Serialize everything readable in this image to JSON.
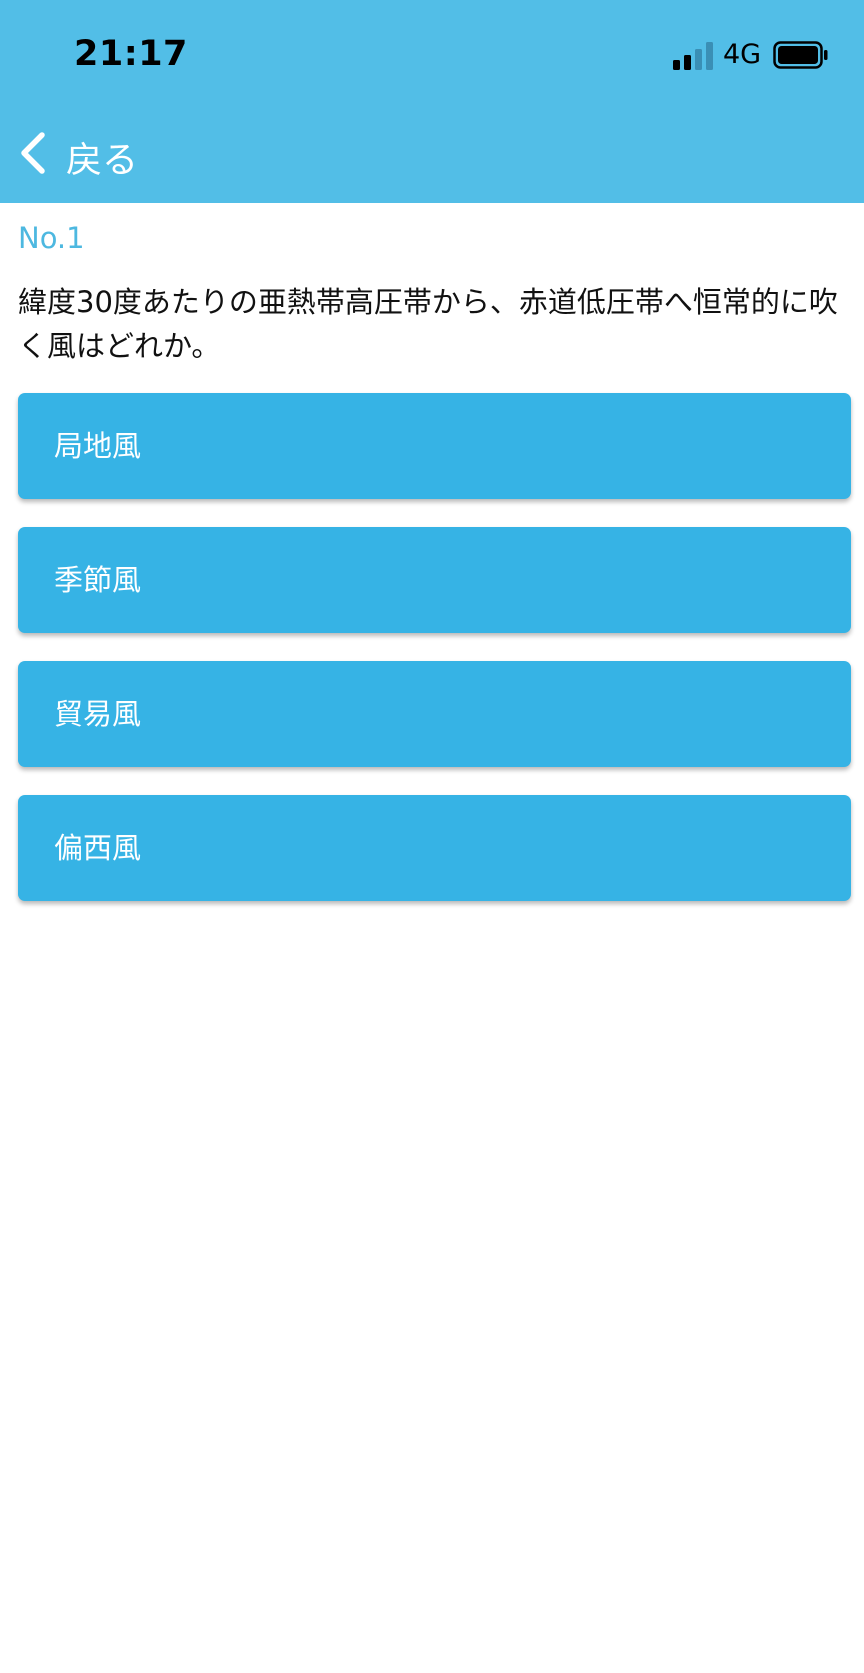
{
  "status_bar": {
    "time": "21:17",
    "network": "4G"
  },
  "nav": {
    "back_label": "戻る",
    "back_icon": "chevron-left-icon"
  },
  "question": {
    "number_label": "No.1",
    "text": "緯度30度あたりの亜熱帯高圧帯から、赤道低圧帯へ恒常的に吹く風はどれか。"
  },
  "choices": [
    {
      "label": "局地風"
    },
    {
      "label": "季節風"
    },
    {
      "label": "貿易風"
    },
    {
      "label": "偏西風"
    }
  ],
  "colors": {
    "header_bg": "#52bee7",
    "choice_bg": "#36b3e5",
    "accent_text": "#4db8e0"
  }
}
